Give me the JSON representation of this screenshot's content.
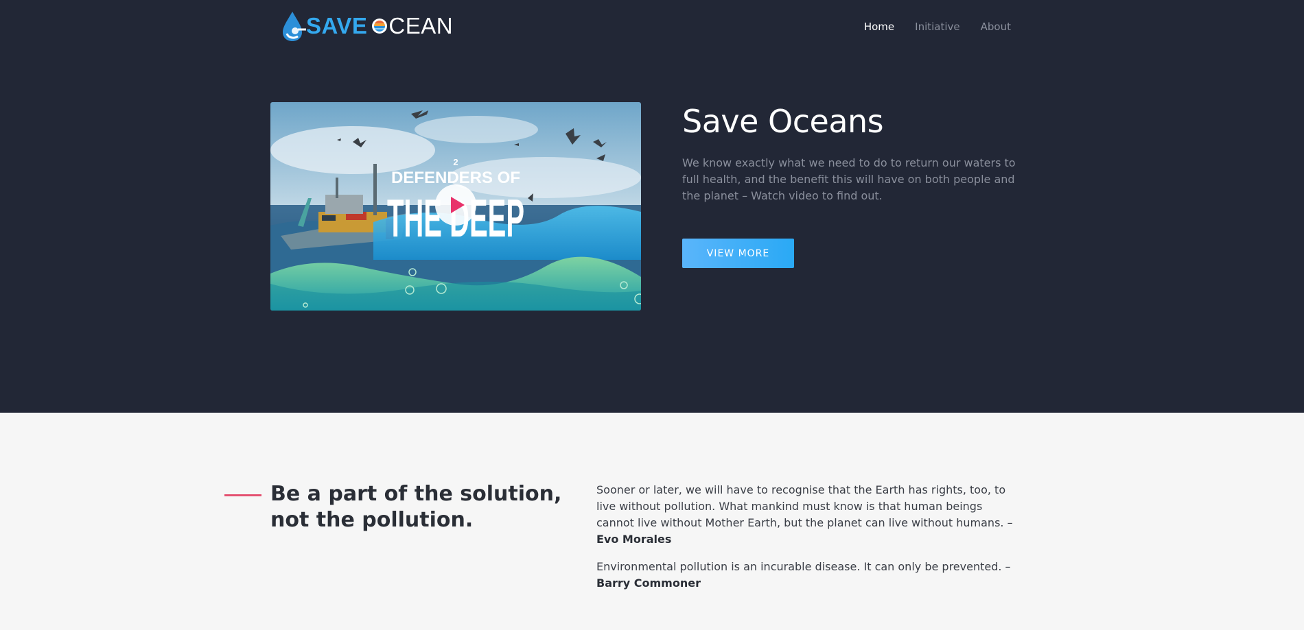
{
  "brand": {
    "save": "SAVE",
    "o_icon": "sunset-ocean-icon",
    "cean": "CEAN",
    "drop_icon": "water-drop-icon"
  },
  "nav": {
    "items": [
      {
        "label": "Home",
        "active": true
      },
      {
        "label": "Initiative",
        "active": false
      },
      {
        "label": "About",
        "active": false
      }
    ]
  },
  "hero": {
    "video": {
      "thumbnail_title_top": "DEFENDERS OF",
      "thumbnail_title_main": "THE DEEP",
      "thumbnail_number": "2",
      "play_icon": "play-icon"
    },
    "title": "Save Oceans",
    "description": "We know exactly what we need to do to return our waters to full health, and the benefit this will have on both people and the planet – Watch video to find out.",
    "button_label": "VIEW MORE"
  },
  "quotes_section": {
    "tagline": "Be a part of the solution, not the pollution.",
    "quote1_text": "Sooner or later, we will have to recognise that the Earth has rights, too, to live without pollution. What mankind must know is that human beings cannot live without Mother Earth, but the planet can live without humans. –",
    "quote1_author": "Evo Morales",
    "quote2_text": "Environmental pollution is an incurable disease. It can only be prevented. –",
    "quote2_author": "Barry Commoner"
  },
  "colors": {
    "hero_bg": "#222736",
    "accent_blue": "#34a9ef",
    "accent_line": "#e45070",
    "play_pink": "#e8336b",
    "section_bg": "#f6f6f6"
  }
}
